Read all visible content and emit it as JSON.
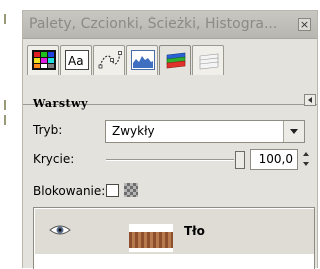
{
  "dock": {
    "title": "Palety, Czcionki, Ścieżki, Histogra...",
    "close_glyph": "×",
    "tabs": [
      {
        "icon": "palettes-icon"
      },
      {
        "icon": "fonts-icon"
      },
      {
        "icon": "paths-icon"
      },
      {
        "icon": "histogram-icon"
      },
      {
        "icon": "layers-icon"
      },
      {
        "icon": "document-history-icon"
      }
    ]
  },
  "layers_panel": {
    "title": "Warstwy",
    "mode_label": "Tryb:",
    "mode_value": "Zwykły",
    "opacity_label": "Krycie:",
    "opacity_value": "100,0",
    "opacity_percent": 100,
    "lock_label": "Blokowanie:",
    "layers": [
      {
        "name": "Tło",
        "visible": true
      }
    ]
  },
  "colors": {
    "dock_bg": "#e4e2dc",
    "selected_row": "#dedcd4"
  }
}
